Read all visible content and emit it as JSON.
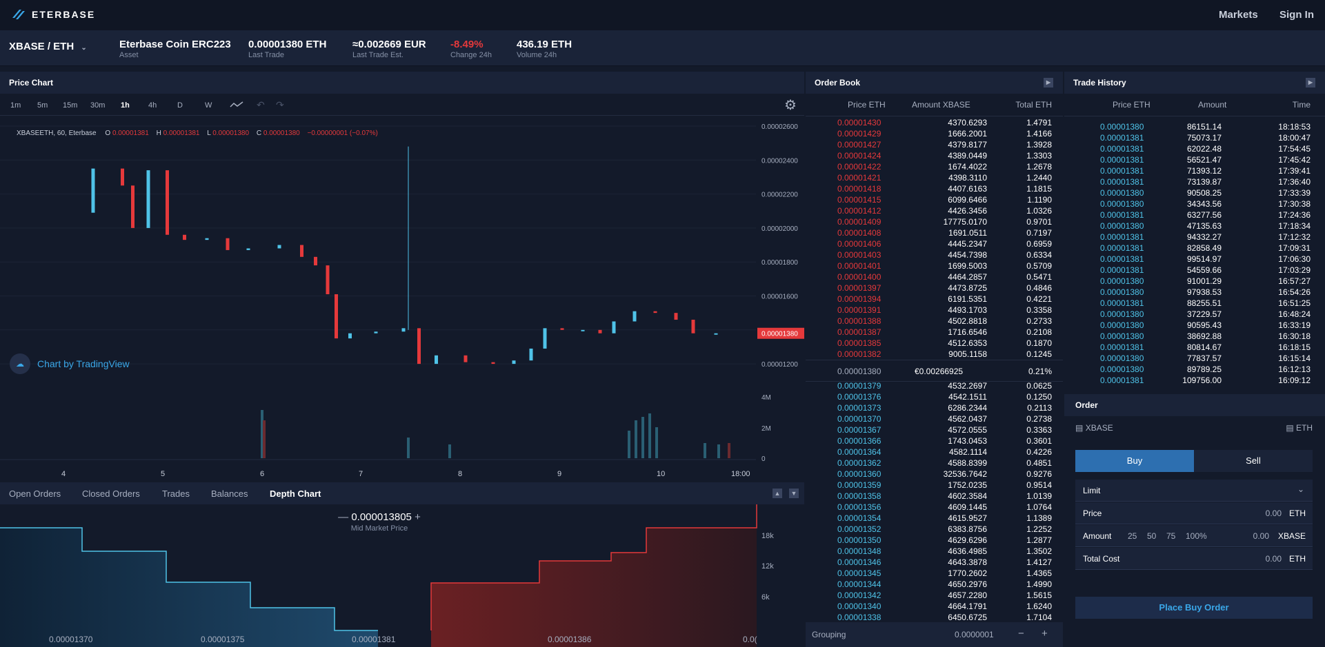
{
  "app": {
    "brand": "ETERBASE",
    "nav_markets": "Markets",
    "nav_signin": "Sign In"
  },
  "ticker": {
    "pair": "XBASE / ETH",
    "asset_name": "Eterbase Coin ERC223",
    "asset_label": "Asset",
    "last_trade": "0.00001380 ETH",
    "last_trade_label": "Last Trade",
    "last_trade_est": "≈0.002669 EUR",
    "last_trade_est_label": "Last Trade Est.",
    "change": "-8.49%",
    "change_label": "Change 24h",
    "volume": "436.19 ETH",
    "volume_label": "Volume 24h"
  },
  "chart": {
    "title": "Price Chart",
    "timeframes": [
      "1m",
      "5m",
      "15m",
      "30m",
      "1h",
      "4h",
      "D",
      "W"
    ],
    "active_timeframe": "1h",
    "legend_symbol": "XBASEETH, 60, Eterbase",
    "ohlc": {
      "o_label": "O",
      "o": "0.00001381",
      "h_label": "H",
      "h": "0.00001381",
      "l_label": "L",
      "l": "0.00001380",
      "c_label": "C",
      "c": "0.00001380",
      "chg": "−0.00000001 (−0.07%)"
    },
    "price_ticks": [
      "0.00002600",
      "0.00002400",
      "0.00002200",
      "0.00002000",
      "0.00001800",
      "0.00001600",
      "0.00001400",
      "0.00001200"
    ],
    "current_price": "0.00001380",
    "volume_ticks": [
      "4M",
      "2M",
      "0"
    ],
    "date_ticks": [
      "4",
      "5",
      "6",
      "7",
      "8",
      "9",
      "10",
      "18:00"
    ],
    "watermark": "Chart by TradingView"
  },
  "bottom_tabs": [
    "Open Orders",
    "Closed Orders",
    "Trades",
    "Balances",
    "Depth Chart"
  ],
  "depth": {
    "mid_price": "0.000013805",
    "mid_label": "Mid Market Price",
    "y_ticks": [
      "18k",
      "12k",
      "6k"
    ],
    "x_ticks": [
      "0.00001370",
      "0.00001375",
      "0.00001381",
      "0.00001386",
      "0.0("
    ]
  },
  "orderbook": {
    "title": "Order Book",
    "headers": [
      "Price ETH",
      "Amount XBASE",
      "Total ETH"
    ],
    "asks": [
      [
        "0.00001430",
        "4370.6293",
        "1.4791"
      ],
      [
        "0.00001429",
        "1666.2001",
        "1.4166"
      ],
      [
        "0.00001427",
        "4379.8177",
        "1.3928"
      ],
      [
        "0.00001424",
        "4389.0449",
        "1.3303"
      ],
      [
        "0.00001422",
        "1674.4022",
        "1.2678"
      ],
      [
        "0.00001421",
        "4398.3110",
        "1.2440"
      ],
      [
        "0.00001418",
        "4407.6163",
        "1.1815"
      ],
      [
        "0.00001415",
        "6099.6466",
        "1.1190"
      ],
      [
        "0.00001412",
        "4426.3456",
        "1.0326"
      ],
      [
        "0.00001409",
        "17775.0170",
        "0.9701"
      ],
      [
        "0.00001408",
        "1691.0511",
        "0.7197"
      ],
      [
        "0.00001406",
        "4445.2347",
        "0.6959"
      ],
      [
        "0.00001403",
        "4454.7398",
        "0.6334"
      ],
      [
        "0.00001401",
        "1699.5003",
        "0.5709"
      ],
      [
        "0.00001400",
        "4464.2857",
        "0.5471"
      ],
      [
        "0.00001397",
        "4473.8725",
        "0.4846"
      ],
      [
        "0.00001394",
        "6191.5351",
        "0.4221"
      ],
      [
        "0.00001391",
        "4493.1703",
        "0.3358"
      ],
      [
        "0.00001388",
        "4502.8818",
        "0.2733"
      ],
      [
        "0.00001387",
        "1716.6546",
        "0.2108"
      ],
      [
        "0.00001385",
        "4512.6353",
        "0.1870"
      ],
      [
        "0.00001382",
        "9005.1158",
        "0.1245"
      ]
    ],
    "spread": [
      "0.00001380",
      "€0.00266925",
      "0.21%"
    ],
    "bids": [
      [
        "0.00001379",
        "4532.2697",
        "0.0625"
      ],
      [
        "0.00001376",
        "4542.1511",
        "0.1250"
      ],
      [
        "0.00001373",
        "6286.2344",
        "0.2113"
      ],
      [
        "0.00001370",
        "4562.0437",
        "0.2738"
      ],
      [
        "0.00001367",
        "4572.0555",
        "0.3363"
      ],
      [
        "0.00001366",
        "1743.0453",
        "0.3601"
      ],
      [
        "0.00001364",
        "4582.1114",
        "0.4226"
      ],
      [
        "0.00001362",
        "4588.8399",
        "0.4851"
      ],
      [
        "0.00001360",
        "32536.7642",
        "0.9276"
      ],
      [
        "0.00001359",
        "1752.0235",
        "0.9514"
      ],
      [
        "0.00001358",
        "4602.3584",
        "1.0139"
      ],
      [
        "0.00001356",
        "4609.1445",
        "1.0764"
      ],
      [
        "0.00001354",
        "4615.9527",
        "1.1389"
      ],
      [
        "0.00001352",
        "6383.8756",
        "1.2252"
      ],
      [
        "0.00001350",
        "4629.6296",
        "1.2877"
      ],
      [
        "0.00001348",
        "4636.4985",
        "1.3502"
      ],
      [
        "0.00001346",
        "4643.3878",
        "1.4127"
      ],
      [
        "0.00001345",
        "1770.2602",
        "1.4365"
      ],
      [
        "0.00001344",
        "4650.2976",
        "1.4990"
      ],
      [
        "0.00001342",
        "4657.2280",
        "1.5615"
      ],
      [
        "0.00001340",
        "4664.1791",
        "1.6240"
      ],
      [
        "0.00001338",
        "6450.6725",
        "1.7104"
      ]
    ],
    "grouping_label": "Grouping",
    "grouping_value": "0.0000001"
  },
  "trade_history": {
    "title": "Trade History",
    "headers": [
      "Price ETH",
      "Amount",
      "Time"
    ],
    "rows": [
      [
        "0.00001380",
        "86151.14",
        "18:18:53"
      ],
      [
        "0.00001381",
        "75073.17",
        "18:00:47"
      ],
      [
        "0.00001381",
        "62022.48",
        "17:54:45"
      ],
      [
        "0.00001381",
        "56521.47",
        "17:45:42"
      ],
      [
        "0.00001381",
        "71393.12",
        "17:39:41"
      ],
      [
        "0.00001381",
        "73139.87",
        "17:36:40"
      ],
      [
        "0.00001380",
        "90508.25",
        "17:33:39"
      ],
      [
        "0.00001380",
        "34343.56",
        "17:30:38"
      ],
      [
        "0.00001381",
        "63277.56",
        "17:24:36"
      ],
      [
        "0.00001380",
        "47135.63",
        "17:18:34"
      ],
      [
        "0.00001381",
        "94332.27",
        "17:12:32"
      ],
      [
        "0.00001381",
        "82858.49",
        "17:09:31"
      ],
      [
        "0.00001381",
        "99514.97",
        "17:06:30"
      ],
      [
        "0.00001381",
        "54559.66",
        "17:03:29"
      ],
      [
        "0.00001380",
        "91001.29",
        "16:57:27"
      ],
      [
        "0.00001380",
        "97938.53",
        "16:54:26"
      ],
      [
        "0.00001381",
        "88255.51",
        "16:51:25"
      ],
      [
        "0.00001380",
        "37229.57",
        "16:48:24"
      ],
      [
        "0.00001380",
        "90595.43",
        "16:33:19"
      ],
      [
        "0.00001380",
        "38692.88",
        "16:30:18"
      ],
      [
        "0.00001381",
        "80814.67",
        "16:18:15"
      ],
      [
        "0.00001380",
        "77837.57",
        "16:15:14"
      ],
      [
        "0.00001380",
        "89789.25",
        "16:12:13"
      ],
      [
        "0.00001381",
        "109756.00",
        "16:09:12"
      ]
    ]
  },
  "order": {
    "title": "Order",
    "base": "XBASE",
    "quote": "ETH",
    "buy": "Buy",
    "sell": "Sell",
    "type": "Limit",
    "price_label": "Price",
    "price_value": "0.00",
    "price_unit": "ETH",
    "amount_label": "Amount",
    "amount_pcts": [
      "25",
      "50",
      "75",
      "100%"
    ],
    "amount_value": "0.00",
    "amount_unit": "XBASE",
    "total_label": "Total Cost",
    "total_value": "0.00",
    "total_unit": "ETH",
    "place": "Place Buy Order"
  },
  "colors": {
    "bid": "#4fc3e8",
    "ask": "#e5393b",
    "accent": "#2d6fb0",
    "bg": "#131a2a",
    "panel": "#1a2338"
  }
}
